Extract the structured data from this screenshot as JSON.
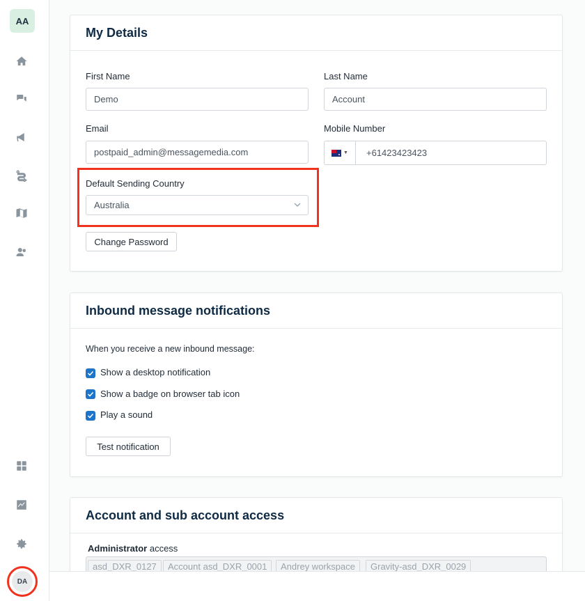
{
  "sidebar": {
    "workspace_initials": "AA",
    "user_initials": "DA",
    "nav_icons": [
      "home-icon",
      "chat-icon",
      "megaphone-icon",
      "workflow-icon",
      "map-icon",
      "contacts-icon"
    ],
    "bottom_icons": [
      "apps-grid-icon",
      "analytics-icon",
      "settings-icon"
    ]
  },
  "my_details": {
    "title": "My Details",
    "first_name_label": "First Name",
    "first_name_value": "Demo",
    "last_name_label": "Last Name",
    "last_name_value": "Account",
    "email_label": "Email",
    "email_value": "postpaid_admin@messagemedia.com",
    "mobile_label": "Mobile Number",
    "mobile_value": "+61423423423",
    "mobile_country_flag": "AU",
    "country_label": "Default Sending Country",
    "country_value": "Australia",
    "change_password": "Change Password"
  },
  "notifications": {
    "title": "Inbound message notifications",
    "intro": "When you receive a new inbound message:",
    "options": [
      {
        "label": "Show a desktop notification",
        "checked": true
      },
      {
        "label": "Show a badge on browser tab icon",
        "checked": true
      },
      {
        "label": "Play a sound",
        "checked": true
      }
    ],
    "test_button": "Test notification"
  },
  "access": {
    "title": "Account and sub account access",
    "role_bold": "Administrator",
    "role_rest": " access",
    "accounts": [
      "asd_DXR_0127",
      "Account asd_DXR_0001",
      "Andrey workspace",
      "Gravity-asd_DXR_0029"
    ]
  },
  "colors": {
    "accent": "#1e74c9",
    "highlight": "#f0321e",
    "title": "#0f2a44"
  }
}
